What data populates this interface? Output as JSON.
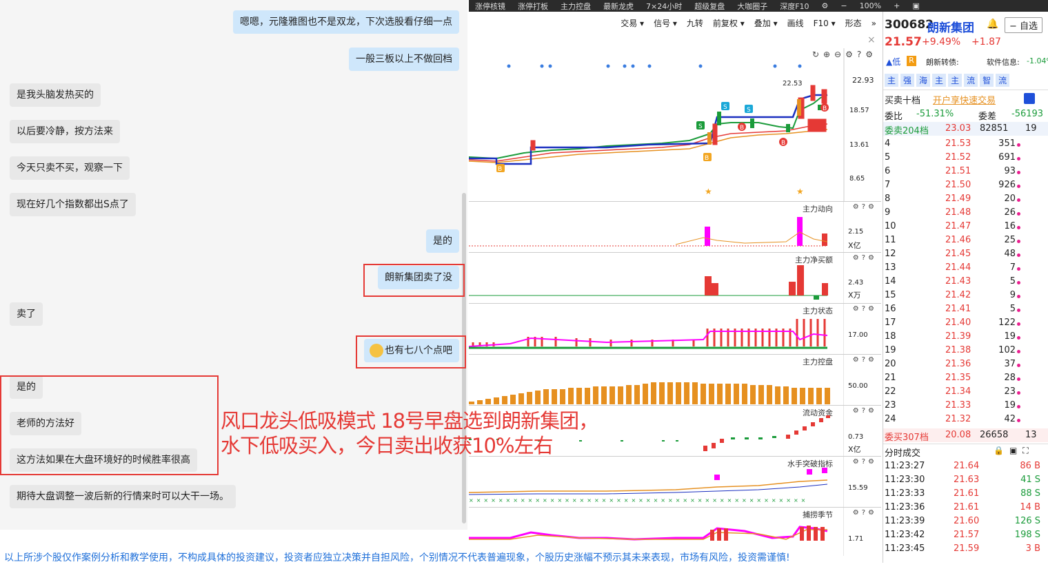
{
  "chat": {
    "messages": [
      {
        "side": "r",
        "text": "嗯嗯，元隆雅图也不是双龙，下次选股看仔细一点"
      },
      {
        "side": "r",
        "text": "一般三板以上不做回档"
      },
      {
        "side": "l",
        "text": "是我头脑发热买的"
      },
      {
        "side": "l",
        "text": "以后要冷静，按方法来"
      },
      {
        "side": "l",
        "text": "今天只卖不买，观察一下"
      },
      {
        "side": "l",
        "text": "现在好几个指数都出S点了"
      },
      {
        "side": "r",
        "text": "是的"
      },
      {
        "side": "r",
        "text": "朗新集团卖了没"
      },
      {
        "side": "l",
        "text": "卖了"
      },
      {
        "side": "r",
        "text": "也有七八个点吧"
      },
      {
        "side": "l",
        "text": "是的"
      },
      {
        "side": "l",
        "text": "老师的方法好"
      },
      {
        "side": "l",
        "text": "这方法如果在大盘环境好的时候胜率很高"
      },
      {
        "side": "l",
        "text": "期待大盘调整一波后新的行情来时可以大干一场。"
      }
    ]
  },
  "overlay": {
    "line1": "风口龙头低吸模式 18号早盘选到朗新集团，",
    "line2": "水下低吸买入，今日卖出收获10%左右"
  },
  "disclaimer": "以上所涉个股仅作案例分析和教学使用，不构成具体的投资建议，投资者应独立决策并自担风险，个别情况不代表普遍现象，个股历史涨幅不预示其未来表现，市场有风险，投资需谨慎!",
  "topnav": [
    "涨停核镜",
    "涨停打板",
    "主力控盘",
    "最新龙虎",
    "7×24小时",
    "超级复盘",
    "大咖圈子",
    "深度F10"
  ],
  "zoom": "100%",
  "toolbar": [
    "交易 ▾",
    "信号 ▾",
    "九转",
    "前复权 ▾",
    "叠加 ▾",
    "画线",
    "F10 ▾",
    "形态"
  ],
  "kline": {
    "price_high_label": "22.53",
    "axis": [
      "22.93",
      "18.57",
      "13.61",
      "8.65"
    ]
  },
  "panels": [
    {
      "title": "主力动向",
      "value": "2.15",
      "unit": "X亿"
    },
    {
      "title": "主力净买额",
      "value": "2.43",
      "unit": "X万"
    },
    {
      "title": "主力状态",
      "value": "17.00",
      "unit": ""
    },
    {
      "title": "主力控盘",
      "value": "50.00",
      "unit": ""
    },
    {
      "title": "流动资金",
      "value": "0.73",
      "unit": "X亿"
    },
    {
      "title": "水手突破指标",
      "value": "15.59",
      "unit": ""
    },
    {
      "title": "捕捞季节",
      "value": "1.71",
      "unit": ""
    }
  ],
  "stock": {
    "code": "300682",
    "name": "朗新集团",
    "self_select": "自选",
    "price": "21.57",
    "change_pct": "+9.49%",
    "change": "+1.87",
    "low_tag": "低",
    "r_tag": "R",
    "convert_label": "朗新转债:",
    "software_label": "软件信息:",
    "software_value": "-1.04%",
    "tags": [
      "主",
      "强",
      "海",
      "主",
      "主",
      "流",
      "智",
      "流"
    ],
    "book_title": "买卖十档",
    "book_link": "开户享快速交易",
    "ratio_label": "委比",
    "ratio_value": "-51.31%",
    "diff_label": "委差",
    "diff_value": "-56193",
    "sell_label": "委卖204档",
    "sell_price": "23.03",
    "sell_vol": "82851",
    "sell_n": "19",
    "buy_label": "委买307档",
    "buy_price": "20.08",
    "buy_vol": "26658",
    "buy_n": "13",
    "trades_title": "分时成交"
  },
  "book": [
    {
      "lv": "4",
      "p": "21.53",
      "v": "351",
      "dot": true
    },
    {
      "lv": "5",
      "p": "21.52",
      "v": "691",
      "dot": true
    },
    {
      "lv": "6",
      "p": "21.51",
      "v": "93",
      "dot": true
    },
    {
      "lv": "7",
      "p": "21.50",
      "v": "926",
      "dot": true
    },
    {
      "lv": "8",
      "p": "21.49",
      "v": "20",
      "dot": true
    },
    {
      "lv": "9",
      "p": "21.48",
      "v": "26",
      "dot": true
    },
    {
      "lv": "10",
      "p": "21.47",
      "v": "16",
      "dot": true
    },
    {
      "lv": "11",
      "p": "21.46",
      "v": "25",
      "dot": true
    },
    {
      "lv": "12",
      "p": "21.45",
      "v": "48",
      "dot": true
    },
    {
      "lv": "13",
      "p": "21.44",
      "v": "7",
      "dot": true
    },
    {
      "lv": "14",
      "p": "21.43",
      "v": "5",
      "dot": true
    },
    {
      "lv": "15",
      "p": "21.42",
      "v": "9",
      "dot": true
    },
    {
      "lv": "16",
      "p": "21.41",
      "v": "5",
      "dot": true
    },
    {
      "lv": "17",
      "p": "21.40",
      "v": "122",
      "dot": true
    },
    {
      "lv": "18",
      "p": "21.39",
      "v": "19",
      "dot": true
    },
    {
      "lv": "19",
      "p": "21.38",
      "v": "102",
      "dot": true
    },
    {
      "lv": "20",
      "p": "21.36",
      "v": "37",
      "dot": true
    },
    {
      "lv": "21",
      "p": "21.35",
      "v": "28",
      "dot": true
    },
    {
      "lv": "22",
      "p": "21.34",
      "v": "23",
      "dot": true
    },
    {
      "lv": "23",
      "p": "21.33",
      "v": "19",
      "dot": true
    },
    {
      "lv": "24",
      "p": "21.32",
      "v": "42",
      "dot": true
    }
  ],
  "trades": [
    {
      "t": "11:23:27",
      "p": "21.64",
      "v": "86 B",
      "c": "#e53935"
    },
    {
      "t": "11:23:30",
      "p": "21.63",
      "v": "41 S",
      "c": "#1a9b3a"
    },
    {
      "t": "11:23:33",
      "p": "21.61",
      "v": "88 S",
      "c": "#1a9b3a"
    },
    {
      "t": "11:23:36",
      "p": "21.61",
      "v": "14 B",
      "c": "#e53935"
    },
    {
      "t": "11:23:39",
      "p": "21.60",
      "v": "126 S",
      "c": "#1a9b3a"
    },
    {
      "t": "11:23:42",
      "p": "21.57",
      "v": "198 S",
      "c": "#1a9b3a"
    },
    {
      "t": "11:23:45",
      "p": "21.59",
      "v": "3 B",
      "c": "#e53935"
    }
  ]
}
